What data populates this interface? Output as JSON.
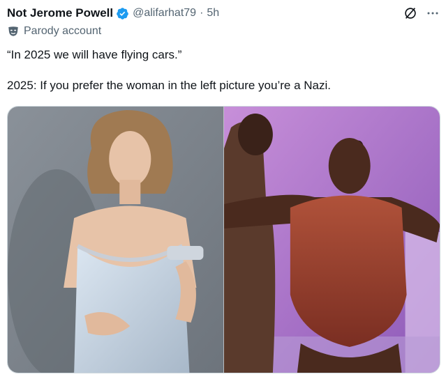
{
  "tweet": {
    "author_name": "Not Jerome Powell",
    "handle": "@alifarhat79",
    "separator": "·",
    "time": "5h",
    "label": "Parody account",
    "line1": "“In 2025 we will have flying cars.”",
    "line2": "2025: If you prefer the woman in the left picture you’re a Nazi."
  },
  "icons": {
    "verified": "verified-badge-icon",
    "grok": "grok-icon",
    "more": "more-icon",
    "parody": "parody-mask-icon"
  },
  "colors": {
    "verified": "#1d9bf0",
    "secondary_text": "#536471",
    "primary_text": "#0f1419"
  }
}
